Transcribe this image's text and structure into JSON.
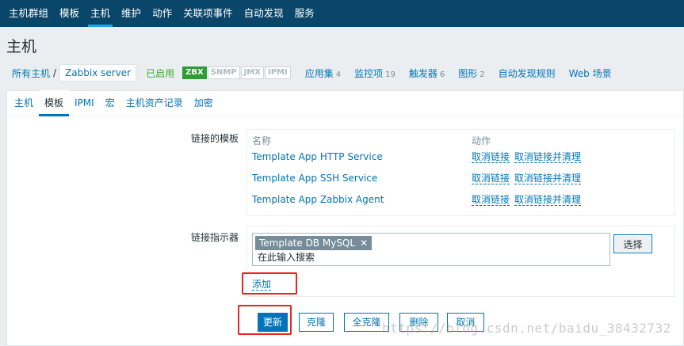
{
  "topnav": [
    "主机群组",
    "模板",
    "主机",
    "维护",
    "动作",
    "关联项事件",
    "自动发现",
    "服务"
  ],
  "page_title": "主机",
  "hostnav": {
    "all_hosts": "所有主机",
    "separator": "/",
    "current": "Zabbix server",
    "status": "已启用",
    "badges": [
      "ZBX",
      "SNMP",
      "JMX",
      "IPMI"
    ],
    "links": [
      {
        "label": "应用集",
        "count": "4"
      },
      {
        "label": "监控项",
        "count": "19"
      },
      {
        "label": "触发器",
        "count": "6"
      },
      {
        "label": "图形",
        "count": "2"
      },
      {
        "label": "自动发现规则",
        "count": ""
      },
      {
        "label": "Web 场景",
        "count": ""
      }
    ]
  },
  "tabs": [
    "主机",
    "模板",
    "IPMI",
    "宏",
    "主机资产记录",
    "加密"
  ],
  "linked_templates": {
    "label": "链接的模板",
    "col_name": "名称",
    "col_action": "动作",
    "rows": [
      {
        "name": "Template App HTTP Service",
        "unlink": "取消链接",
        "unlink_clear": "取消链接并清理"
      },
      {
        "name": "Template App SSH Service",
        "unlink": "取消链接",
        "unlink_clear": "取消链接并清理"
      },
      {
        "name": "Template App Zabbix Agent",
        "unlink": "取消链接",
        "unlink_clear": "取消链接并清理"
      }
    ]
  },
  "link_indicator": {
    "label": "链接指示器",
    "chip": "Template DB MySQL",
    "placeholder": "在此输入搜索",
    "select_button": "选择",
    "add_link": "添加"
  },
  "buttons": {
    "update": "更新",
    "clone": "克隆",
    "full_clone": "全克隆",
    "delete": "删除",
    "cancel": "取消"
  },
  "watermark": "https://blog.csdn.net/baidu_38432732",
  "colors": {
    "topnav_bg": "#0a466a",
    "link": "#0275b8",
    "enabled": "#3bab2d",
    "highlight": "#e8261e"
  }
}
